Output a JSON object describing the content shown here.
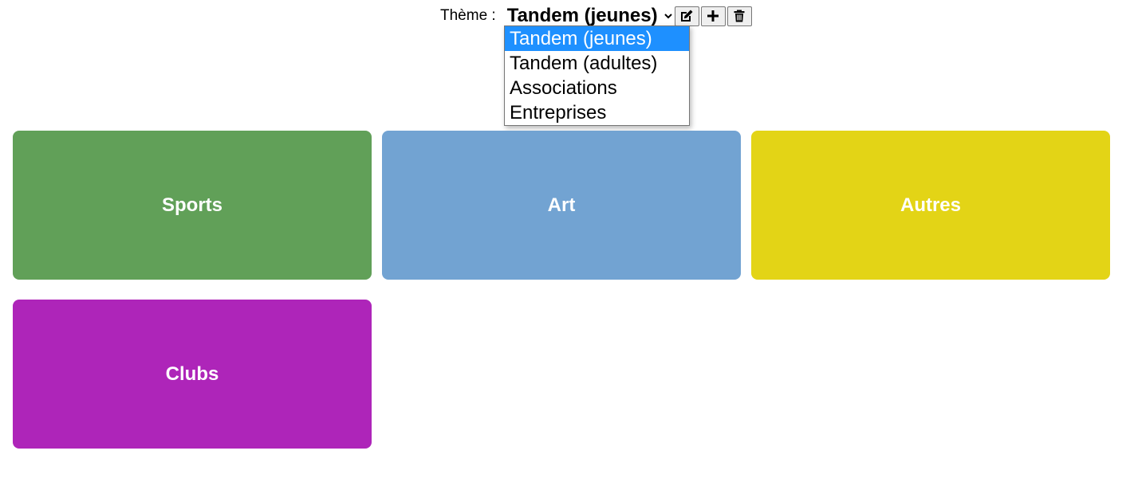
{
  "theme": {
    "label": "Thème :",
    "selected": "Tandem (jeunes)",
    "options": [
      "Tandem (jeunes)",
      "Tandem (adultes)",
      "Associations",
      "Entreprises"
    ]
  },
  "actions": {
    "edit_icon": "edit-icon",
    "add_icon": "plus-icon",
    "delete_icon": "trash-icon"
  },
  "categories": [
    {
      "label": "Sports",
      "color": "#61a058"
    },
    {
      "label": "Art",
      "color": "#72a3d2"
    },
    {
      "label": "Autres",
      "color": "#e3d416"
    },
    {
      "label": "Clubs",
      "color": "#ae25b9"
    }
  ],
  "colors": {
    "dropdown_highlight": "#1e90ff"
  }
}
